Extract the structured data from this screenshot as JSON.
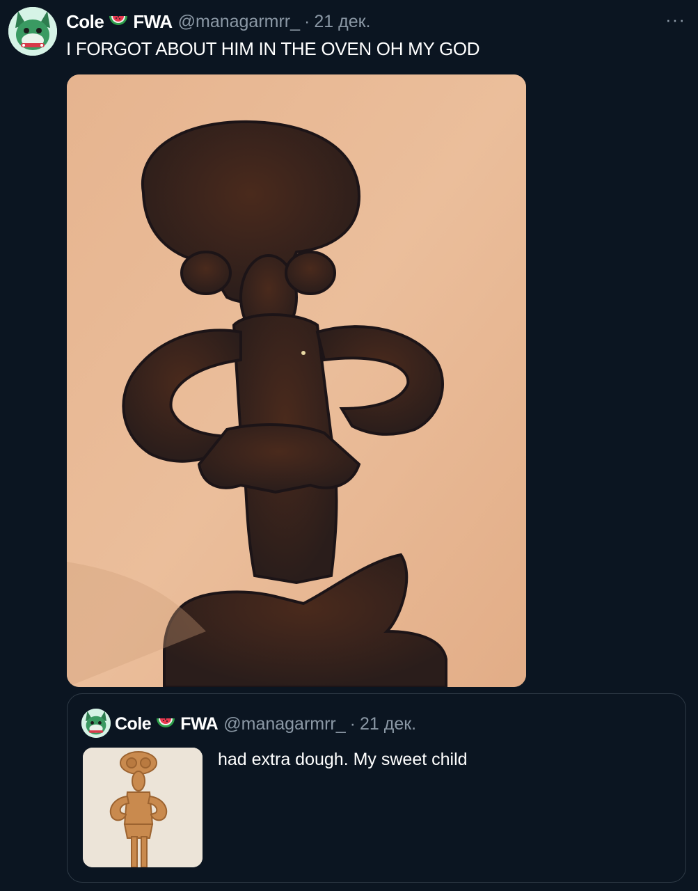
{
  "tweet": {
    "author_first": "Cole",
    "author_second": "FWA",
    "handle": "@managarmrr_",
    "separator": "·",
    "date": "21 дек.",
    "more_label": "···",
    "text": "I FORGOT ABOUT HIM IN THE OVEN OH MY GOD",
    "avatar_icon": "avatar-cartoon-icon",
    "name_emoji_icon": "watermelon-icon"
  },
  "quoted_tweet": {
    "author_first": "Cole",
    "author_second": "FWA",
    "handle": "@managarmrr_",
    "separator": "·",
    "date": "21 дек.",
    "text": "had extra dough. My sweet child"
  },
  "colors": {
    "background": "#0b1521",
    "secondary_text": "#8b98a5",
    "border": "#2f3b47"
  }
}
